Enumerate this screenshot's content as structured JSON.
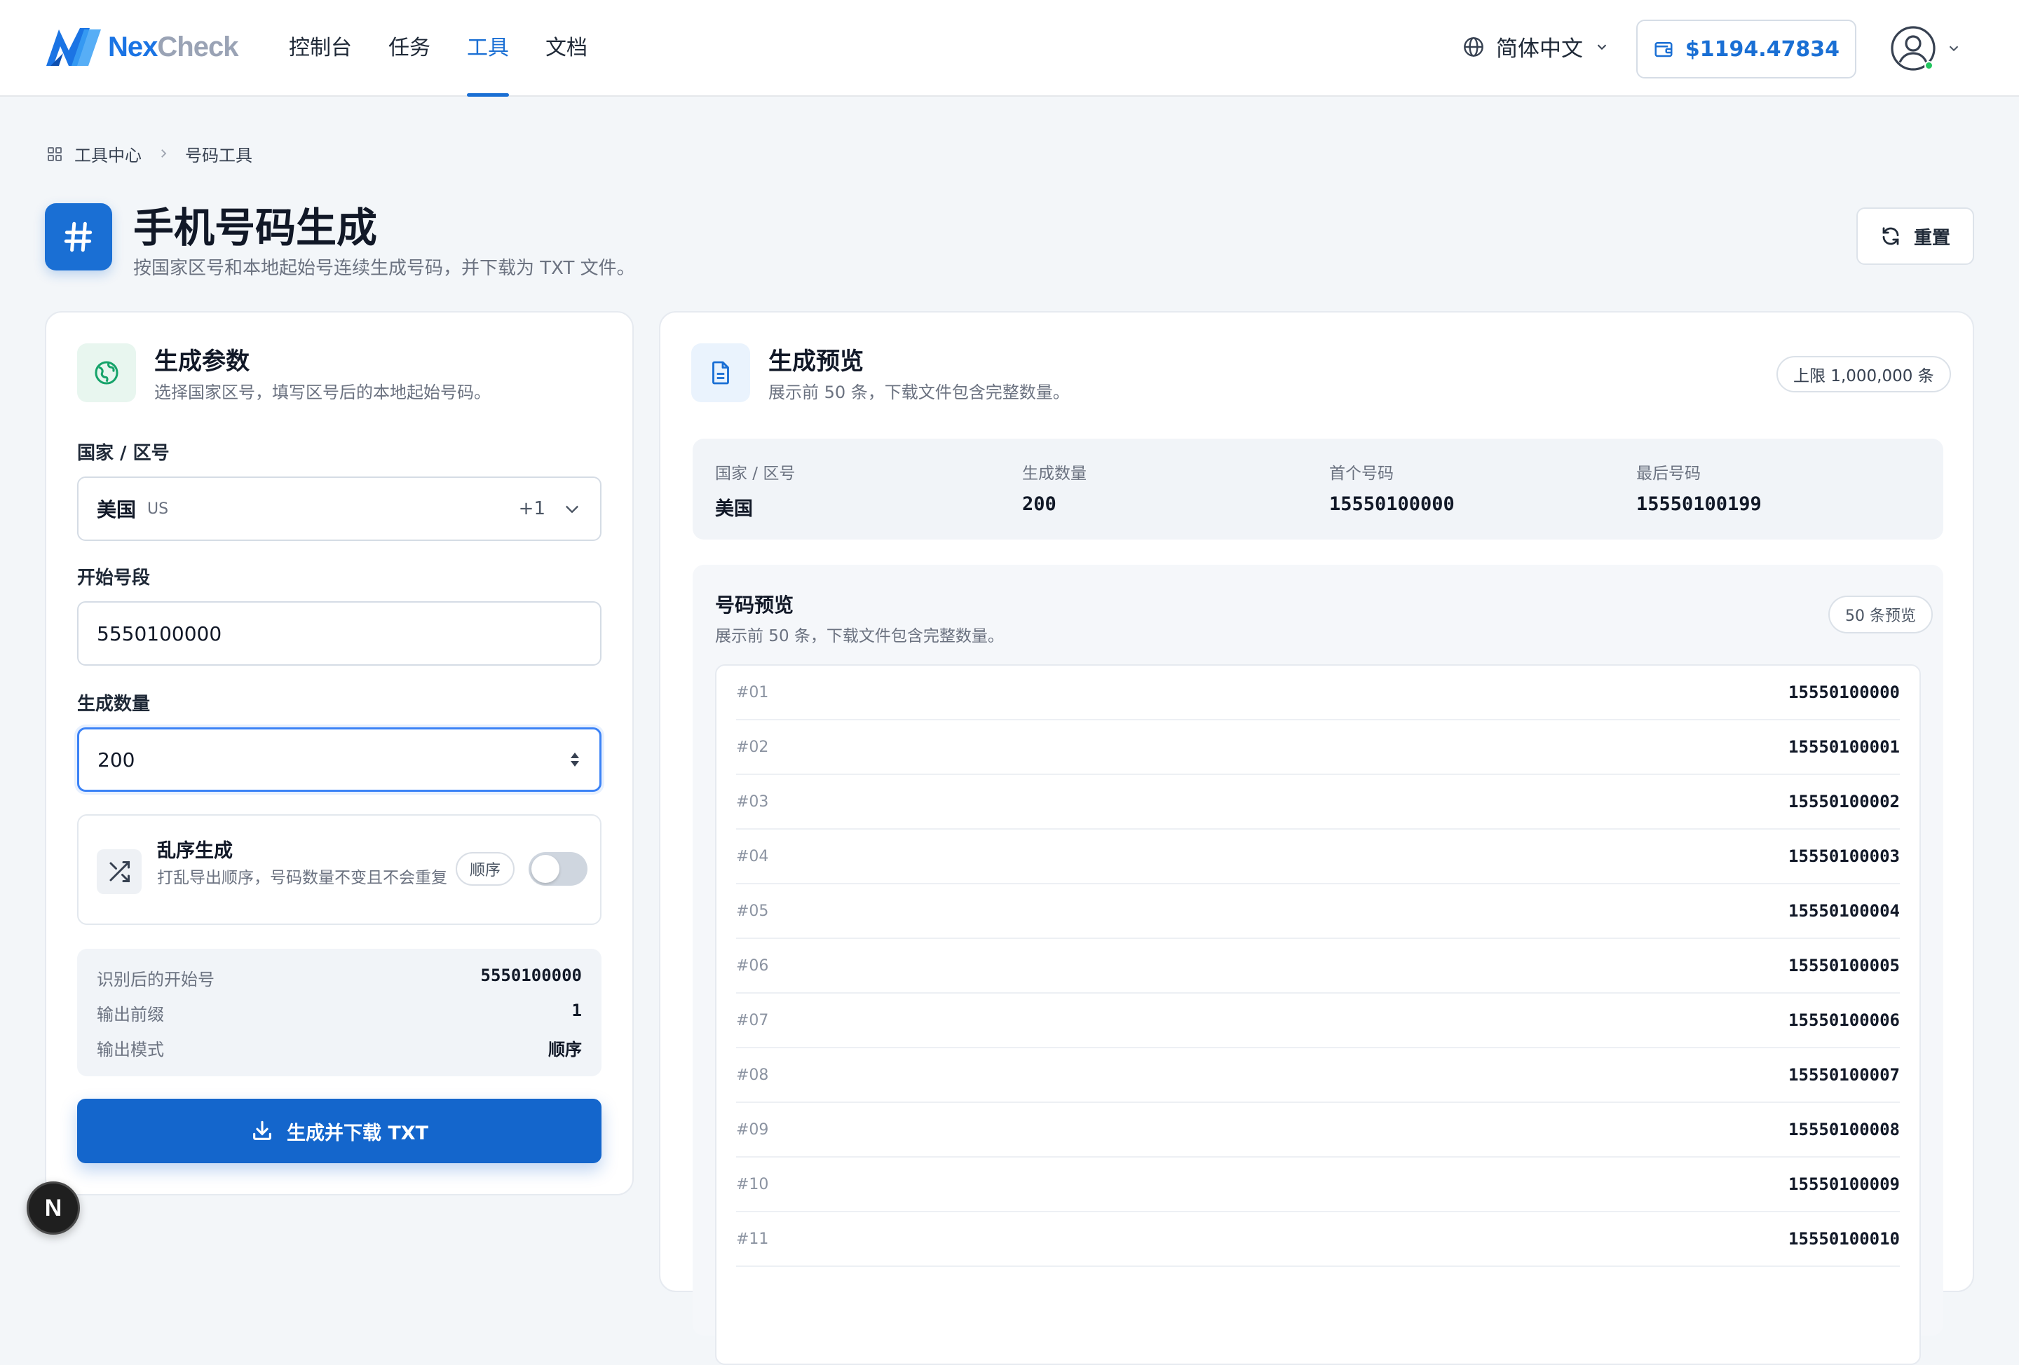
{
  "brand": {
    "part1": "Nex",
    "part2": "Check"
  },
  "nav": [
    {
      "label": "控制台",
      "active": false
    },
    {
      "label": "任务",
      "active": false
    },
    {
      "label": "工具",
      "active": true
    },
    {
      "label": "文档",
      "active": false
    }
  ],
  "header": {
    "language": "简体中文",
    "balance": "$1194.47834"
  },
  "breadcrumb": {
    "root": "工具中心",
    "current": "号码工具"
  },
  "page": {
    "title": "手机号码生成",
    "subtitle": "按国家区号和本地起始号连续生成号码，并下载为 TXT 文件。",
    "reset_label": "重置"
  },
  "params": {
    "title": "生成参数",
    "subtitle": "选择国家区号，填写区号后的本地起始号码。",
    "country_label": "国家 / 区号",
    "country_value": "美国",
    "country_code": "US",
    "country_dial": "+1",
    "start_label": "开始号段",
    "start_value": "5550100000",
    "count_label": "生成数量",
    "count_value": "200",
    "shuffle": {
      "title": "乱序生成",
      "desc": "打乱导出顺序，号码数量不变且不会重复",
      "state_label": "顺序",
      "enabled": false
    },
    "summary": [
      {
        "key": "识别后的开始号",
        "value": "5550100000"
      },
      {
        "key": "输出前缀",
        "value": "1"
      },
      {
        "key": "输出模式",
        "value": "顺序"
      }
    ],
    "download_label": "生成并下载 TXT"
  },
  "preview": {
    "title": "生成预览",
    "subtitle": "展示前 50 条，下载文件包含完整数量。",
    "limit_label": "上限 1,000,000 条",
    "stats": [
      {
        "key": "国家 / 区号",
        "value": "美国"
      },
      {
        "key": "生成数量",
        "value": "200"
      },
      {
        "key": "首个号码",
        "value": "15550100000"
      },
      {
        "key": "最后号码",
        "value": "15550100199"
      }
    ],
    "list_title": "号码预览",
    "list_subtitle": "展示前 50 条，下载文件包含完整数量。",
    "list_count_label": "50 条预览",
    "rows": [
      {
        "idx": "#01",
        "num": "15550100000"
      },
      {
        "idx": "#02",
        "num": "15550100001"
      },
      {
        "idx": "#03",
        "num": "15550100002"
      },
      {
        "idx": "#04",
        "num": "15550100003"
      },
      {
        "idx": "#05",
        "num": "15550100004"
      },
      {
        "idx": "#06",
        "num": "15550100005"
      },
      {
        "idx": "#07",
        "num": "15550100006"
      },
      {
        "idx": "#08",
        "num": "15550100007"
      },
      {
        "idx": "#09",
        "num": "15550100008"
      },
      {
        "idx": "#10",
        "num": "15550100009"
      },
      {
        "idx": "#11",
        "num": "15550100010"
      }
    ]
  },
  "dev_badge": "N",
  "colors": {
    "accent": "#1a6fd4",
    "primary_button": "#1466cc",
    "online": "#22c55e"
  }
}
